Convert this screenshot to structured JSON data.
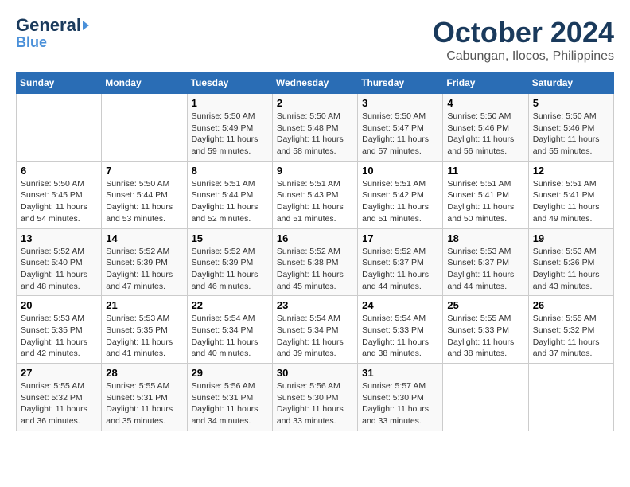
{
  "header": {
    "logo_line1": "General",
    "logo_line2": "Blue",
    "title": "October 2024",
    "subtitle": "Cabungan, Ilocos, Philippines"
  },
  "calendar": {
    "weekdays": [
      "Sunday",
      "Monday",
      "Tuesday",
      "Wednesday",
      "Thursday",
      "Friday",
      "Saturday"
    ],
    "weeks": [
      [
        {
          "day": "",
          "detail": ""
        },
        {
          "day": "",
          "detail": ""
        },
        {
          "day": "1",
          "detail": "Sunrise: 5:50 AM\nSunset: 5:49 PM\nDaylight: 11 hours\nand 59 minutes."
        },
        {
          "day": "2",
          "detail": "Sunrise: 5:50 AM\nSunset: 5:48 PM\nDaylight: 11 hours\nand 58 minutes."
        },
        {
          "day": "3",
          "detail": "Sunrise: 5:50 AM\nSunset: 5:47 PM\nDaylight: 11 hours\nand 57 minutes."
        },
        {
          "day": "4",
          "detail": "Sunrise: 5:50 AM\nSunset: 5:46 PM\nDaylight: 11 hours\nand 56 minutes."
        },
        {
          "day": "5",
          "detail": "Sunrise: 5:50 AM\nSunset: 5:46 PM\nDaylight: 11 hours\nand 55 minutes."
        }
      ],
      [
        {
          "day": "6",
          "detail": "Sunrise: 5:50 AM\nSunset: 5:45 PM\nDaylight: 11 hours\nand 54 minutes."
        },
        {
          "day": "7",
          "detail": "Sunrise: 5:50 AM\nSunset: 5:44 PM\nDaylight: 11 hours\nand 53 minutes."
        },
        {
          "day": "8",
          "detail": "Sunrise: 5:51 AM\nSunset: 5:44 PM\nDaylight: 11 hours\nand 52 minutes."
        },
        {
          "day": "9",
          "detail": "Sunrise: 5:51 AM\nSunset: 5:43 PM\nDaylight: 11 hours\nand 51 minutes."
        },
        {
          "day": "10",
          "detail": "Sunrise: 5:51 AM\nSunset: 5:42 PM\nDaylight: 11 hours\nand 51 minutes."
        },
        {
          "day": "11",
          "detail": "Sunrise: 5:51 AM\nSunset: 5:41 PM\nDaylight: 11 hours\nand 50 minutes."
        },
        {
          "day": "12",
          "detail": "Sunrise: 5:51 AM\nSunset: 5:41 PM\nDaylight: 11 hours\nand 49 minutes."
        }
      ],
      [
        {
          "day": "13",
          "detail": "Sunrise: 5:52 AM\nSunset: 5:40 PM\nDaylight: 11 hours\nand 48 minutes."
        },
        {
          "day": "14",
          "detail": "Sunrise: 5:52 AM\nSunset: 5:39 PM\nDaylight: 11 hours\nand 47 minutes."
        },
        {
          "day": "15",
          "detail": "Sunrise: 5:52 AM\nSunset: 5:39 PM\nDaylight: 11 hours\nand 46 minutes."
        },
        {
          "day": "16",
          "detail": "Sunrise: 5:52 AM\nSunset: 5:38 PM\nDaylight: 11 hours\nand 45 minutes."
        },
        {
          "day": "17",
          "detail": "Sunrise: 5:52 AM\nSunset: 5:37 PM\nDaylight: 11 hours\nand 44 minutes."
        },
        {
          "day": "18",
          "detail": "Sunrise: 5:53 AM\nSunset: 5:37 PM\nDaylight: 11 hours\nand 44 minutes."
        },
        {
          "day": "19",
          "detail": "Sunrise: 5:53 AM\nSunset: 5:36 PM\nDaylight: 11 hours\nand 43 minutes."
        }
      ],
      [
        {
          "day": "20",
          "detail": "Sunrise: 5:53 AM\nSunset: 5:35 PM\nDaylight: 11 hours\nand 42 minutes."
        },
        {
          "day": "21",
          "detail": "Sunrise: 5:53 AM\nSunset: 5:35 PM\nDaylight: 11 hours\nand 41 minutes."
        },
        {
          "day": "22",
          "detail": "Sunrise: 5:54 AM\nSunset: 5:34 PM\nDaylight: 11 hours\nand 40 minutes."
        },
        {
          "day": "23",
          "detail": "Sunrise: 5:54 AM\nSunset: 5:34 PM\nDaylight: 11 hours\nand 39 minutes."
        },
        {
          "day": "24",
          "detail": "Sunrise: 5:54 AM\nSunset: 5:33 PM\nDaylight: 11 hours\nand 38 minutes."
        },
        {
          "day": "25",
          "detail": "Sunrise: 5:55 AM\nSunset: 5:33 PM\nDaylight: 11 hours\nand 38 minutes."
        },
        {
          "day": "26",
          "detail": "Sunrise: 5:55 AM\nSunset: 5:32 PM\nDaylight: 11 hours\nand 37 minutes."
        }
      ],
      [
        {
          "day": "27",
          "detail": "Sunrise: 5:55 AM\nSunset: 5:32 PM\nDaylight: 11 hours\nand 36 minutes."
        },
        {
          "day": "28",
          "detail": "Sunrise: 5:55 AM\nSunset: 5:31 PM\nDaylight: 11 hours\nand 35 minutes."
        },
        {
          "day": "29",
          "detail": "Sunrise: 5:56 AM\nSunset: 5:31 PM\nDaylight: 11 hours\nand 34 minutes."
        },
        {
          "day": "30",
          "detail": "Sunrise: 5:56 AM\nSunset: 5:30 PM\nDaylight: 11 hours\nand 33 minutes."
        },
        {
          "day": "31",
          "detail": "Sunrise: 5:57 AM\nSunset: 5:30 PM\nDaylight: 11 hours\nand 33 minutes."
        },
        {
          "day": "",
          "detail": ""
        },
        {
          "day": "",
          "detail": ""
        }
      ]
    ]
  }
}
